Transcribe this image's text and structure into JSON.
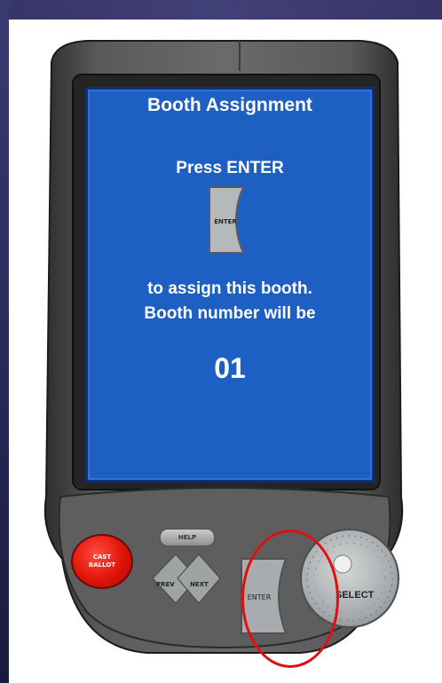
{
  "screen": {
    "title": "Booth Assignment",
    "prompt": "Press ENTER",
    "enter_icon_label": "ENTER",
    "line1": "to assign this booth.",
    "line2": "Booth number will be",
    "booth_number": "01"
  },
  "buttons": {
    "cast_ballot_line1": "CAST",
    "cast_ballot_line2": "BALLOT",
    "help": "HELP",
    "prev": "PREV",
    "next": "NEXT",
    "enter": "ENTER",
    "select": "SELECT"
  },
  "colors": {
    "screen_blue": "#1e5fc4",
    "cast_ballot_red": "#e01408",
    "highlight_red": "#e01010",
    "device_gray": "#4a4a4a"
  }
}
